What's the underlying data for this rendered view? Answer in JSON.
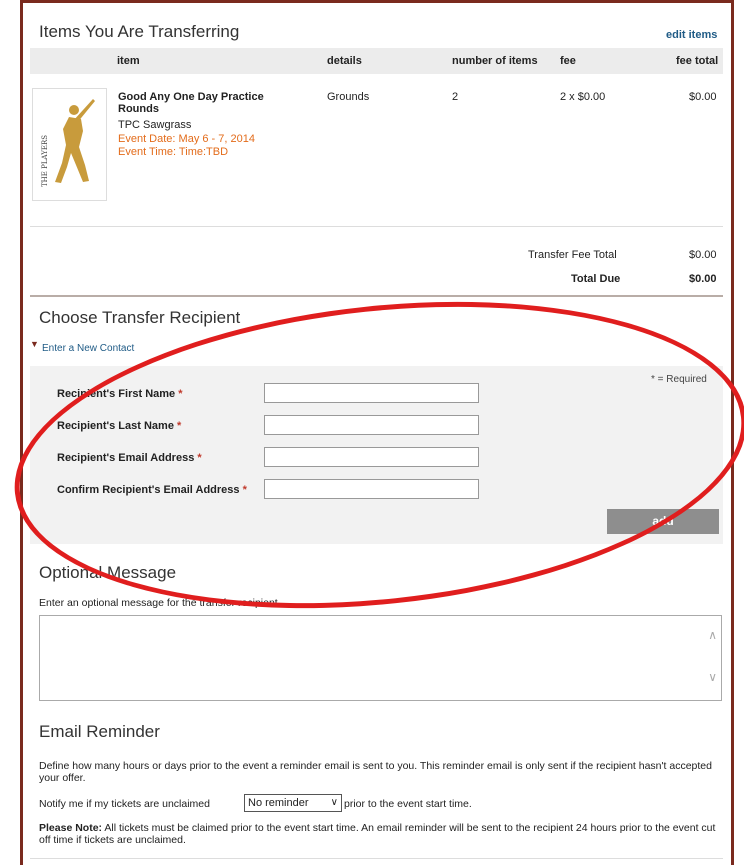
{
  "transfer_section": {
    "title": "Items You Are Transferring",
    "edit_link": "edit items",
    "columns": [
      "item",
      "details",
      "number of items",
      "fee",
      "fee total"
    ],
    "item": {
      "thumb_text": "THE PLAYERS",
      "name": "Good Any One Day Practice Rounds",
      "venue": "TPC Sawgrass",
      "event_date": "Event Date: May 6 - 7, 2014",
      "event_time": "Event Time: Time:TBD",
      "details": "Grounds",
      "quantity": "2",
      "fee": "2 x $0.00",
      "fee_total": "$0.00"
    },
    "transfer_fee_total_label": "Transfer Fee Total",
    "transfer_fee_total_value": "$0.00",
    "total_due_label": "Total Due",
    "total_due_value": "$0.00"
  },
  "recipient_section": {
    "title": "Choose Transfer Recipient",
    "toggle_label": "Enter a New Contact",
    "required_note": "* = Required",
    "fields": [
      {
        "label": "Recipient's First Name",
        "value": ""
      },
      {
        "label": "Recipient's Last Name",
        "value": ""
      },
      {
        "label": "Recipient's Email Address",
        "value": ""
      },
      {
        "label": "Confirm Recipient's Email Address",
        "value": ""
      }
    ],
    "required_marker": "*",
    "add_button": "add"
  },
  "message_section": {
    "title": "Optional Message",
    "instruction": "Enter an optional message for the transfer recipient.",
    "message_value": ""
  },
  "reminder_section": {
    "title": "Email Reminder",
    "description": "Define how many hours or days prior to the event a reminder email is sent to you. This reminder email is only sent if the recipient hasn't accepted your offer.",
    "notify_prefix": "Notify me if my tickets are unclaimed",
    "select_value": "No reminder",
    "notify_suffix": "prior to the event start time.",
    "note_label": "Please Note:",
    "note_text": "All tickets must be claimed prior to the event start time. An email reminder will be sent to the recipient 24 hours prior to the event cut off time if tickets are unclaimed."
  },
  "colors": {
    "frame": "#7a2a1e",
    "link": "#1f5b86",
    "event_orange": "#e36c1b",
    "annotation_red": "#e01e1e",
    "button_gray": "#8e8e8e"
  },
  "icons": {
    "toggle": "triangle-down-icon",
    "select": "chevron-down-icon",
    "scroll_up": "chevron-up-icon",
    "scroll_down": "chevron-down-icon"
  }
}
